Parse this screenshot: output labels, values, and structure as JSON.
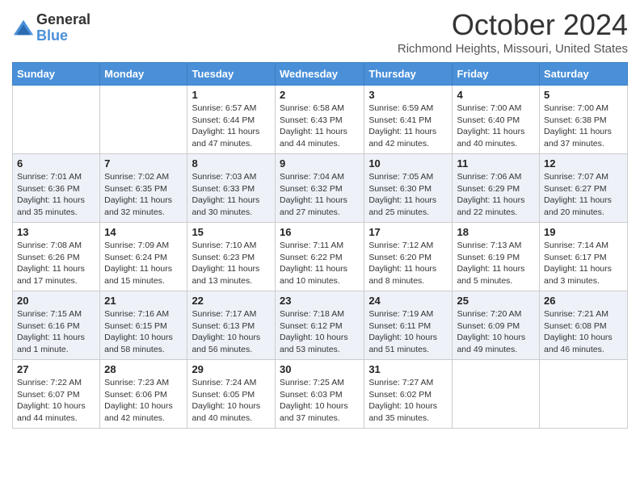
{
  "logo": {
    "general": "General",
    "blue": "Blue"
  },
  "title": "October 2024",
  "location": "Richmond Heights, Missouri, United States",
  "weekdays": [
    "Sunday",
    "Monday",
    "Tuesday",
    "Wednesday",
    "Thursday",
    "Friday",
    "Saturday"
  ],
  "weeks": [
    [
      {
        "day": "",
        "detail": ""
      },
      {
        "day": "",
        "detail": ""
      },
      {
        "day": "1",
        "detail": "Sunrise: 6:57 AM\nSunset: 6:44 PM\nDaylight: 11 hours and 47 minutes."
      },
      {
        "day": "2",
        "detail": "Sunrise: 6:58 AM\nSunset: 6:43 PM\nDaylight: 11 hours and 44 minutes."
      },
      {
        "day": "3",
        "detail": "Sunrise: 6:59 AM\nSunset: 6:41 PM\nDaylight: 11 hours and 42 minutes."
      },
      {
        "day": "4",
        "detail": "Sunrise: 7:00 AM\nSunset: 6:40 PM\nDaylight: 11 hours and 40 minutes."
      },
      {
        "day": "5",
        "detail": "Sunrise: 7:00 AM\nSunset: 6:38 PM\nDaylight: 11 hours and 37 minutes."
      }
    ],
    [
      {
        "day": "6",
        "detail": "Sunrise: 7:01 AM\nSunset: 6:36 PM\nDaylight: 11 hours and 35 minutes."
      },
      {
        "day": "7",
        "detail": "Sunrise: 7:02 AM\nSunset: 6:35 PM\nDaylight: 11 hours and 32 minutes."
      },
      {
        "day": "8",
        "detail": "Sunrise: 7:03 AM\nSunset: 6:33 PM\nDaylight: 11 hours and 30 minutes."
      },
      {
        "day": "9",
        "detail": "Sunrise: 7:04 AM\nSunset: 6:32 PM\nDaylight: 11 hours and 27 minutes."
      },
      {
        "day": "10",
        "detail": "Sunrise: 7:05 AM\nSunset: 6:30 PM\nDaylight: 11 hours and 25 minutes."
      },
      {
        "day": "11",
        "detail": "Sunrise: 7:06 AM\nSunset: 6:29 PM\nDaylight: 11 hours and 22 minutes."
      },
      {
        "day": "12",
        "detail": "Sunrise: 7:07 AM\nSunset: 6:27 PM\nDaylight: 11 hours and 20 minutes."
      }
    ],
    [
      {
        "day": "13",
        "detail": "Sunrise: 7:08 AM\nSunset: 6:26 PM\nDaylight: 11 hours and 17 minutes."
      },
      {
        "day": "14",
        "detail": "Sunrise: 7:09 AM\nSunset: 6:24 PM\nDaylight: 11 hours and 15 minutes."
      },
      {
        "day": "15",
        "detail": "Sunrise: 7:10 AM\nSunset: 6:23 PM\nDaylight: 11 hours and 13 minutes."
      },
      {
        "day": "16",
        "detail": "Sunrise: 7:11 AM\nSunset: 6:22 PM\nDaylight: 11 hours and 10 minutes."
      },
      {
        "day": "17",
        "detail": "Sunrise: 7:12 AM\nSunset: 6:20 PM\nDaylight: 11 hours and 8 minutes."
      },
      {
        "day": "18",
        "detail": "Sunrise: 7:13 AM\nSunset: 6:19 PM\nDaylight: 11 hours and 5 minutes."
      },
      {
        "day": "19",
        "detail": "Sunrise: 7:14 AM\nSunset: 6:17 PM\nDaylight: 11 hours and 3 minutes."
      }
    ],
    [
      {
        "day": "20",
        "detail": "Sunrise: 7:15 AM\nSunset: 6:16 PM\nDaylight: 11 hours and 1 minute."
      },
      {
        "day": "21",
        "detail": "Sunrise: 7:16 AM\nSunset: 6:15 PM\nDaylight: 10 hours and 58 minutes."
      },
      {
        "day": "22",
        "detail": "Sunrise: 7:17 AM\nSunset: 6:13 PM\nDaylight: 10 hours and 56 minutes."
      },
      {
        "day": "23",
        "detail": "Sunrise: 7:18 AM\nSunset: 6:12 PM\nDaylight: 10 hours and 53 minutes."
      },
      {
        "day": "24",
        "detail": "Sunrise: 7:19 AM\nSunset: 6:11 PM\nDaylight: 10 hours and 51 minutes."
      },
      {
        "day": "25",
        "detail": "Sunrise: 7:20 AM\nSunset: 6:09 PM\nDaylight: 10 hours and 49 minutes."
      },
      {
        "day": "26",
        "detail": "Sunrise: 7:21 AM\nSunset: 6:08 PM\nDaylight: 10 hours and 46 minutes."
      }
    ],
    [
      {
        "day": "27",
        "detail": "Sunrise: 7:22 AM\nSunset: 6:07 PM\nDaylight: 10 hours and 44 minutes."
      },
      {
        "day": "28",
        "detail": "Sunrise: 7:23 AM\nSunset: 6:06 PM\nDaylight: 10 hours and 42 minutes."
      },
      {
        "day": "29",
        "detail": "Sunrise: 7:24 AM\nSunset: 6:05 PM\nDaylight: 10 hours and 40 minutes."
      },
      {
        "day": "30",
        "detail": "Sunrise: 7:25 AM\nSunset: 6:03 PM\nDaylight: 10 hours and 37 minutes."
      },
      {
        "day": "31",
        "detail": "Sunrise: 7:27 AM\nSunset: 6:02 PM\nDaylight: 10 hours and 35 minutes."
      },
      {
        "day": "",
        "detail": ""
      },
      {
        "day": "",
        "detail": ""
      }
    ]
  ]
}
